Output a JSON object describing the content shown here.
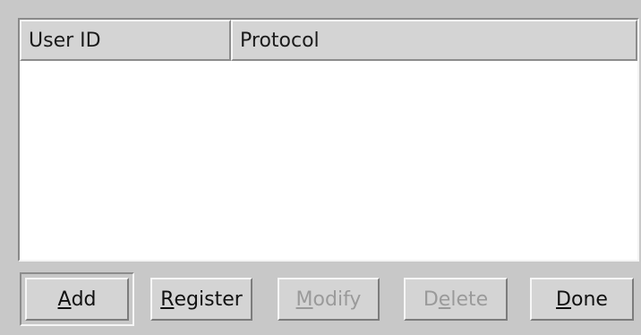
{
  "table": {
    "columns": [
      {
        "label": "User ID"
      },
      {
        "label": "Protocol"
      }
    ],
    "rows": []
  },
  "buttons": {
    "add": {
      "pre": "",
      "mnemonic": "A",
      "post": "dd",
      "enabled": true,
      "focused": true
    },
    "register": {
      "pre": "",
      "mnemonic": "R",
      "post": "egister",
      "enabled": true
    },
    "modify": {
      "pre": "",
      "mnemonic": "M",
      "post": "odify",
      "enabled": false
    },
    "delete": {
      "pre": "D",
      "mnemonic": "e",
      "post": "lete",
      "enabled": false
    },
    "done": {
      "pre": "",
      "mnemonic": "D",
      "post": "one",
      "enabled": true
    }
  }
}
